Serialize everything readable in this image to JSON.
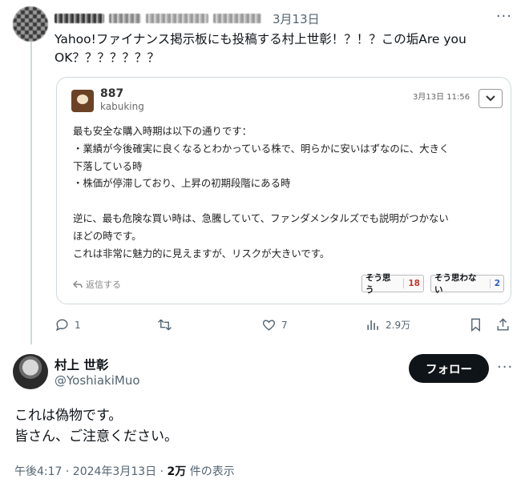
{
  "top_tweet": {
    "date": "3月13日",
    "text": "Yahoo!ファイナンス掲示板にも投稿する村上世彰！？！？この垢Are you OK？？？？？？？"
  },
  "quoted_card": {
    "poster_id": "887",
    "poster_sub": "kabuking",
    "timestamp": "3月13日 11:56",
    "lines": [
      "最も安全な購入時期は以下の通りです：",
      "・業績が今後確実に良くなるとわかっている株で、明らかに安いはずなのに、大きく",
      "下落している時",
      "・株価が停滞しており、上昇の初期段階にある時",
      "",
      "逆に、最も危険な買い時は、急騰していて、ファンダメンタルズでも説明がつかない",
      "ほどの時です。",
      "これは非常に魅力的に見えますが、リスクが大きいです。"
    ],
    "reply_label": "返信する",
    "agree_label": "そう思う",
    "agree_count": "18",
    "disagree_label": "そう思わない",
    "disagree_count": "2"
  },
  "actions": {
    "replies": "1",
    "retweets": "",
    "likes": "7",
    "views": "2.9万"
  },
  "reply_tweet": {
    "name": "村上 世彰",
    "handle": "@YoshiakiMuo",
    "follow_label": "フォロー",
    "text_line1": "これは偽物です。",
    "text_line2": "皆さん、ご注意ください。",
    "meta_time": "午後4:17 · 2024年3月13日 · ",
    "meta_views": "2万",
    "meta_views_suffix": " 件の表示"
  },
  "colors": {
    "text": "#0f1419",
    "secondary": "#536471",
    "border": "#cfd9de",
    "agree": "#c0392b",
    "disagree": "#2b5fc0"
  },
  "icons": [
    "more-icon",
    "chevron-down-icon",
    "reply-arrow-icon",
    "comment-icon",
    "retweet-icon",
    "like-icon",
    "views-icon",
    "bookmark-icon",
    "share-icon"
  ]
}
